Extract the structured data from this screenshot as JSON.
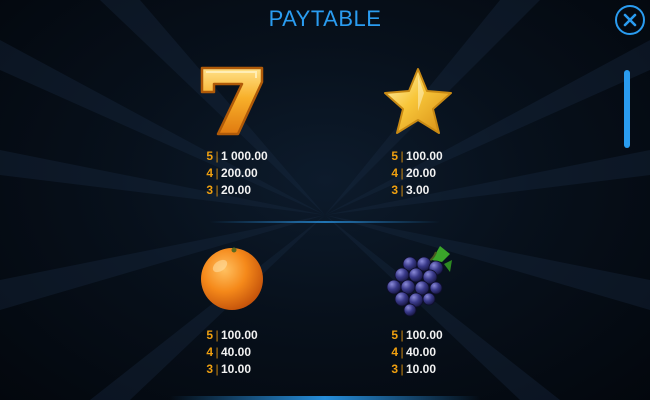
{
  "title": "PAYTABLE",
  "close_icon": "close-icon",
  "separator": "|",
  "accent_color": "#2a9cf0",
  "count_color": "#f0a010",
  "symbols": [
    {
      "icon": "seven-icon",
      "pays": [
        {
          "count": "5",
          "value": "1 000.00"
        },
        {
          "count": "4",
          "value": "200.00"
        },
        {
          "count": "3",
          "value": "20.00"
        }
      ]
    },
    {
      "icon": "star-icon",
      "pays": [
        {
          "count": "5",
          "value": "100.00"
        },
        {
          "count": "4",
          "value": "20.00"
        },
        {
          "count": "3",
          "value": "3.00"
        }
      ]
    },
    {
      "icon": "orange-icon",
      "pays": [
        {
          "count": "5",
          "value": "100.00"
        },
        {
          "count": "4",
          "value": "40.00"
        },
        {
          "count": "3",
          "value": "10.00"
        }
      ]
    },
    {
      "icon": "grapes-icon",
      "pays": [
        {
          "count": "5",
          "value": "100.00"
        },
        {
          "count": "4",
          "value": "40.00"
        },
        {
          "count": "3",
          "value": "10.00"
        }
      ]
    }
  ]
}
